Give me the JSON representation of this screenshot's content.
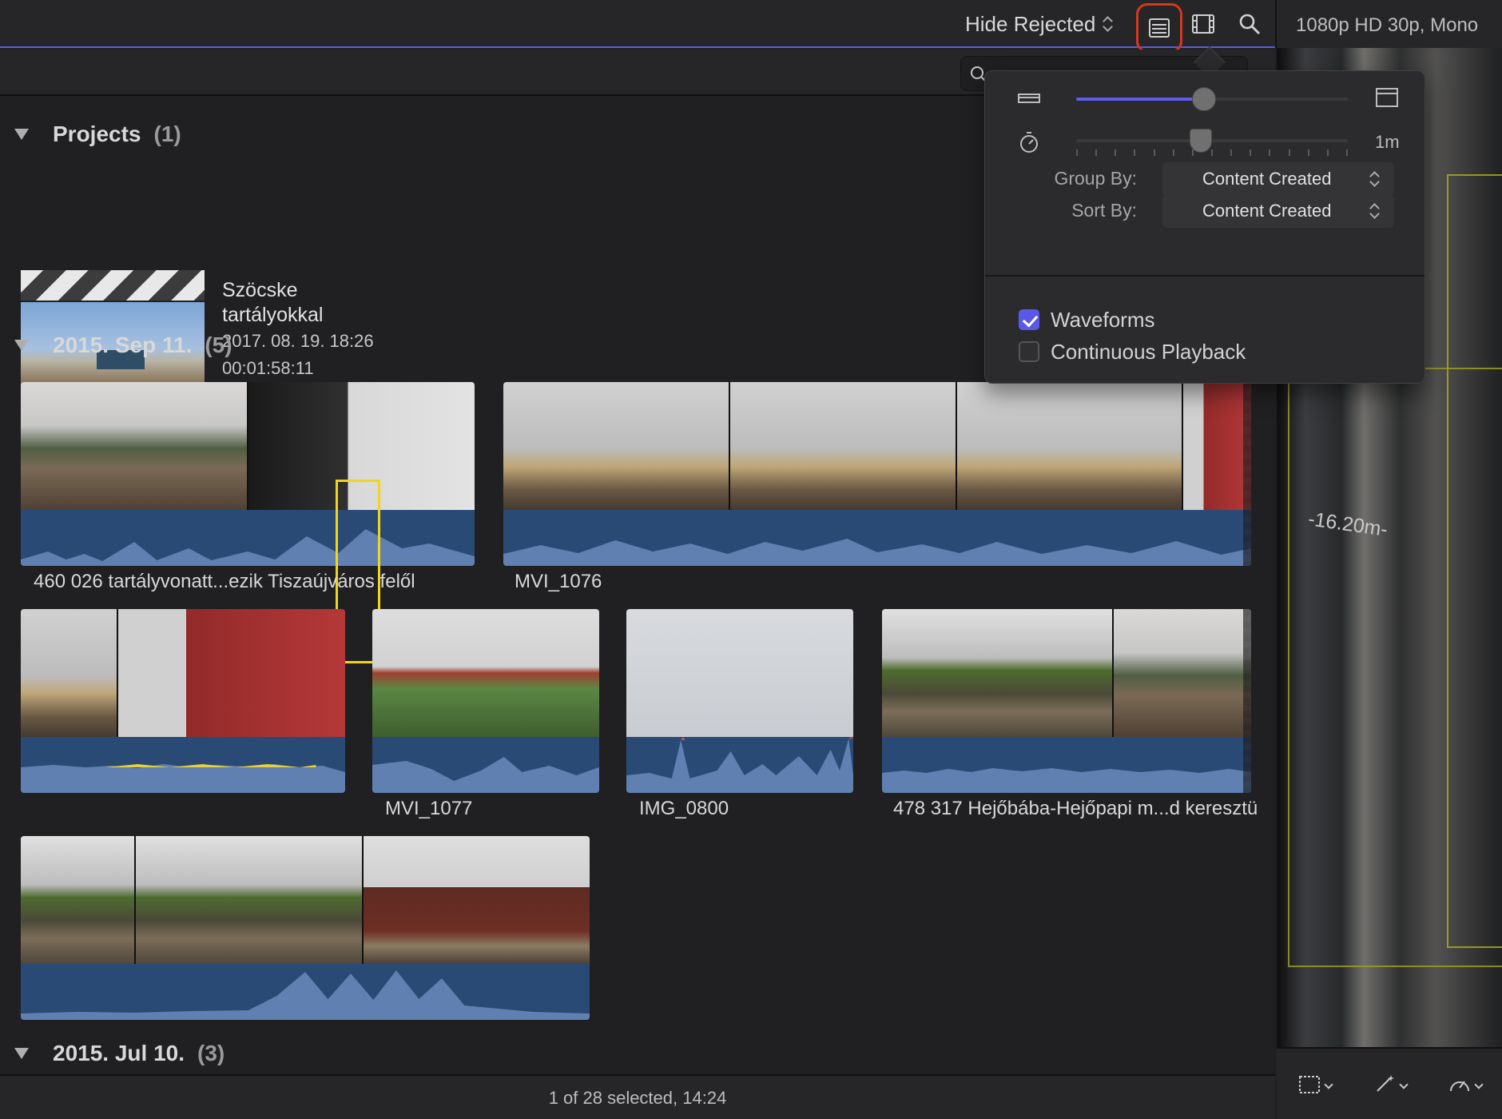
{
  "toolbar": {
    "filter": "Hide Rejected",
    "format": "1080p HD 30p, Mono"
  },
  "sections": [
    {
      "title": "Projects",
      "count": "(1)"
    },
    {
      "title": "2015. Sep 11.",
      "count": "(5)"
    },
    {
      "title": "2015. Jul 10.",
      "count": "(3)"
    }
  ],
  "project": {
    "title_line1": "Szöcske",
    "title_line2": "tartályokkal",
    "date": "2017. 08. 19. 18:26",
    "duration": "00:01:58:11"
  },
  "clips": [
    {
      "name": "460 026 tartályvonatt...ezik Tiszaújváros felől"
    },
    {
      "name": "MVI_1076"
    },
    {
      "name": "MVI_1077"
    },
    {
      "name": "IMG_0800"
    },
    {
      "name": "478 317 Hejőbába-Hejőpapi m...d keresztü"
    }
  ],
  "popover": {
    "duration": "1m",
    "group_by_label": "Group By:",
    "group_by_value": "Content Created",
    "sort_by_label": "Sort By:",
    "sort_by_value": "Content Created",
    "waveforms": "Waveforms",
    "continuous_playback": "Continuous Playback",
    "clip_height_level": 0.47,
    "duration_zoom_level": 0.46
  },
  "status": "1 of 28 selected, 14:24",
  "viewer": {
    "label": "-16.20m-"
  },
  "colors": {
    "accent": "#5e5df0",
    "highlight_border": "#d4381e",
    "selection": "#f2d51b",
    "waveform": "#2a4a76"
  }
}
